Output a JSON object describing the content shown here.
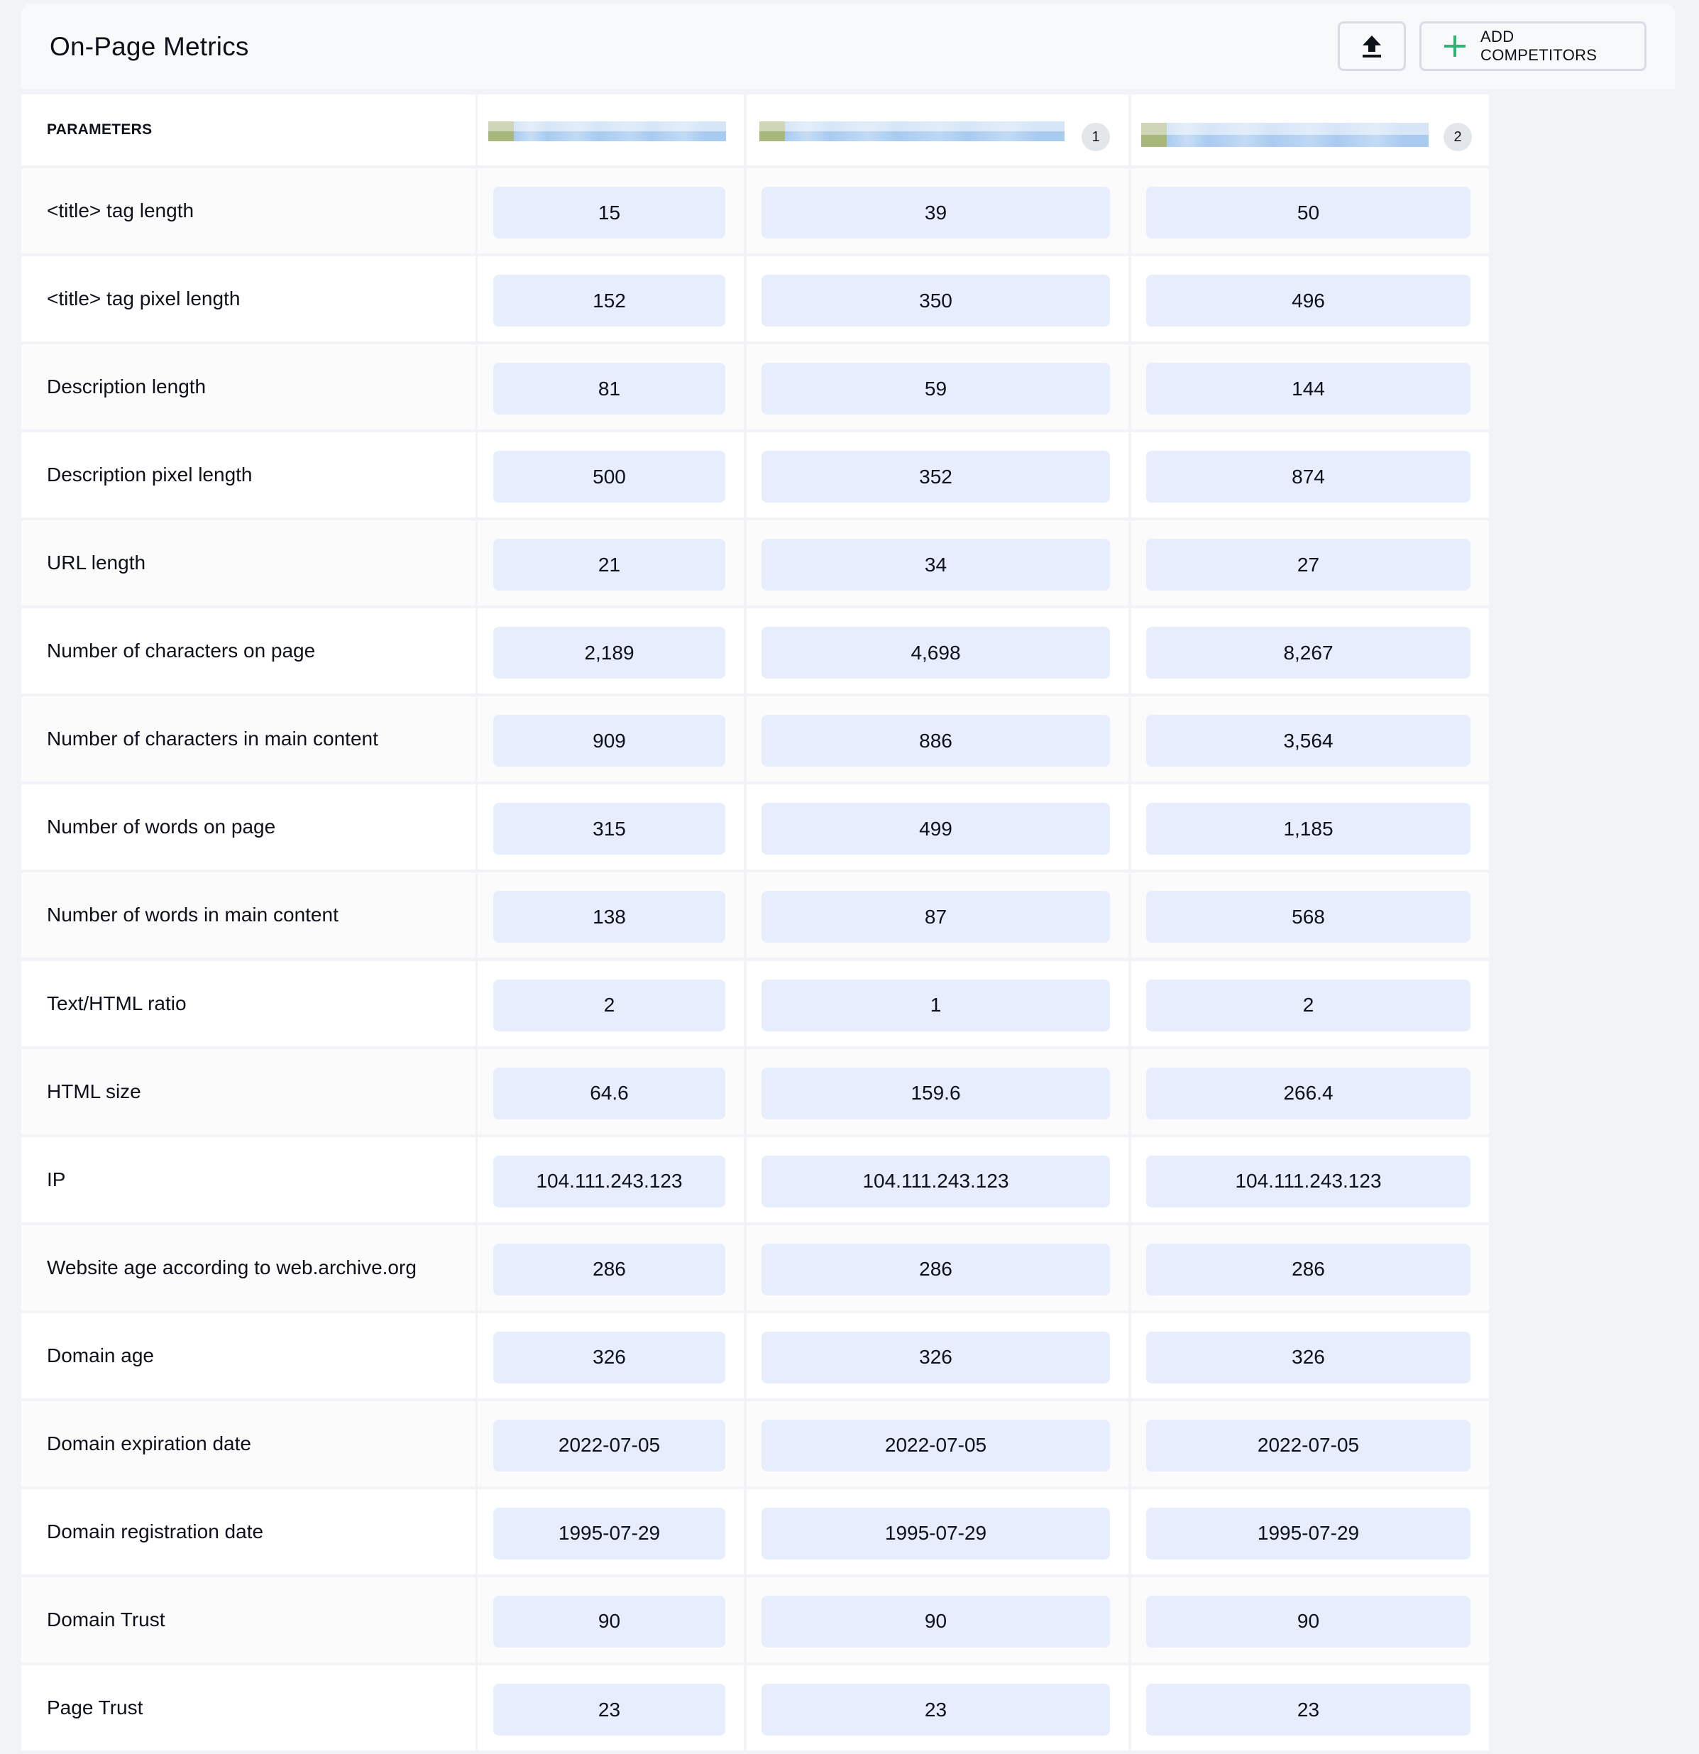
{
  "header": {
    "title": "On-Page Metrics",
    "export_icon": "upload-icon",
    "add_competitors_icon": "plus-icon",
    "add_competitors_label": "ADD COMPETITORS",
    "accent_color": "#2bb673"
  },
  "table": {
    "parameters_header": "PARAMETERS",
    "columns": [
      {
        "name_redacted": true,
        "badge": null
      },
      {
        "name_redacted": true,
        "badge": "1"
      },
      {
        "name_redacted": true,
        "badge": "2"
      }
    ],
    "rows": [
      {
        "label": "<title> tag length",
        "values": [
          "15",
          "39",
          "50"
        ]
      },
      {
        "label": "<title> tag pixel length",
        "values": [
          "152",
          "350",
          "496"
        ]
      },
      {
        "label": "Description length",
        "values": [
          "81",
          "59",
          "144"
        ]
      },
      {
        "label": "Description pixel length",
        "values": [
          "500",
          "352",
          "874"
        ]
      },
      {
        "label": "URL length",
        "values": [
          "21",
          "34",
          "27"
        ]
      },
      {
        "label": "Number of characters on page",
        "values": [
          "2,189",
          "4,698",
          "8,267"
        ]
      },
      {
        "label": "Number of characters in main content",
        "values": [
          "909",
          "886",
          "3,564"
        ]
      },
      {
        "label": "Number of words on page",
        "values": [
          "315",
          "499",
          "1,185"
        ]
      },
      {
        "label": "Number of words in main content",
        "values": [
          "138",
          "87",
          "568"
        ]
      },
      {
        "label": "Text/HTML ratio",
        "values": [
          "2",
          "1",
          "2"
        ]
      },
      {
        "label": "HTML size",
        "values": [
          "64.6",
          "159.6",
          "266.4"
        ]
      },
      {
        "label": "IP",
        "values": [
          "104.111.243.123",
          "104.111.243.123",
          "104.111.243.123"
        ]
      },
      {
        "label": "Website age according to web.archive.org",
        "values": [
          "286",
          "286",
          "286"
        ]
      },
      {
        "label": "Domain age",
        "values": [
          "326",
          "326",
          "326"
        ]
      },
      {
        "label": "Domain expiration date",
        "values": [
          "2022-07-05",
          "2022-07-05",
          "2022-07-05"
        ]
      },
      {
        "label": "Domain registration date",
        "values": [
          "1995-07-29",
          "1995-07-29",
          "1995-07-29"
        ]
      },
      {
        "label": "Domain Trust",
        "values": [
          "90",
          "90",
          "90"
        ]
      },
      {
        "label": "Page Trust",
        "values": [
          "23",
          "23",
          "23"
        ]
      }
    ]
  }
}
